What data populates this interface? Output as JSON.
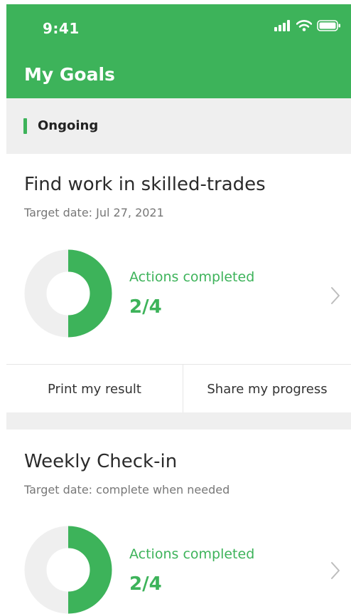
{
  "status_bar": {
    "time": "9:41",
    "icons": [
      "signal-icon",
      "wifi-icon",
      "battery-icon"
    ]
  },
  "header": {
    "title": "My Goals"
  },
  "section": {
    "label": "Ongoing"
  },
  "goals": [
    {
      "title": "Find work in skilled-trades",
      "target": "Target date: Jul 27, 2021",
      "actions_label": "Actions completed",
      "actions_value": "2/4",
      "progress": 0.5
    },
    {
      "title": "Weekly Check-in",
      "target": "Target date: complete when needed",
      "actions_label": "Actions completed",
      "actions_value": "2/4",
      "progress": 0.5
    }
  ],
  "actions": {
    "print_label": "Print my result",
    "share_label": "Share my progress"
  },
  "colors": {
    "brand": "#3db35a",
    "track": "#efefef",
    "section_bg": "#efefef"
  }
}
